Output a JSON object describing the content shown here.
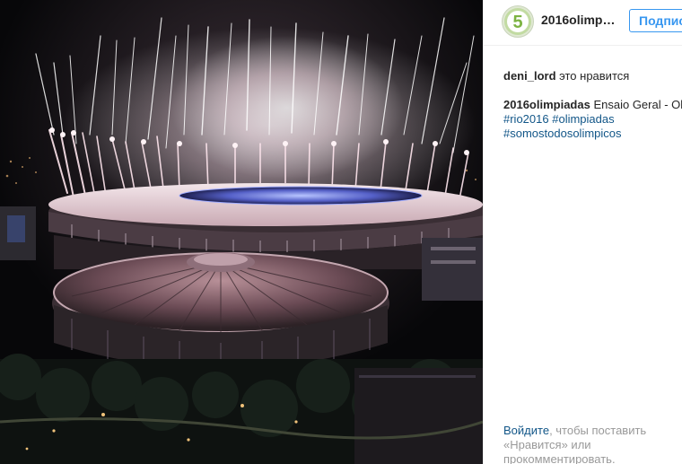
{
  "post": {
    "username": "2016olimpia...",
    "follow_label": "Подпис",
    "likes": {
      "liker": "deni_lord",
      "text": "это нравится"
    },
    "caption": {
      "username": "2016olimpiadas",
      "text": "Ensaio Geral - Oli",
      "tags": [
        "#rio2016",
        "#olimpiadas",
        "#somostodosolimpicos"
      ]
    },
    "login_prompt": {
      "link": "Войдите",
      "line1_rest": ", чтобы поставить",
      "line2": "«Нравится» или",
      "line3": "прокомментировать."
    }
  },
  "photo": {
    "subject": "stadium-fireworks-photo"
  },
  "avatar": {
    "glyph": "5",
    "accent": "#7cb342"
  },
  "colors": {
    "link": "#125688",
    "follow": "#3897f0",
    "muted": "#999999"
  }
}
